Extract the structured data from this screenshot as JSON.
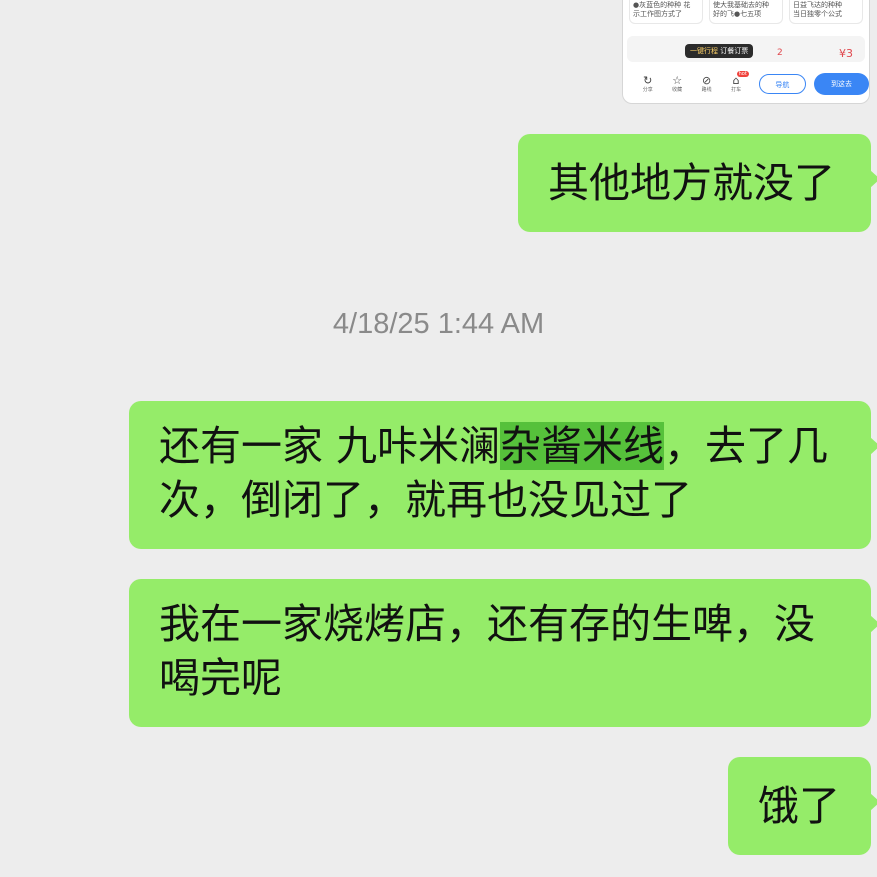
{
  "shared_image": {
    "cards": [
      {
        "line1": "●灰蓝色的种种 花",
        "line2": "示工作图方式了"
      },
      {
        "line1": "使大我基础去的种",
        "line2": "好的飞●七五项"
      },
      {
        "line1": "日益飞达的种种",
        "line2": "当日独零个公式"
      }
    ],
    "pill_prefix": "一键行程",
    "pill_text": "订餐订票",
    "number_a": "2",
    "number_b": "¥3",
    "toolbar": [
      {
        "icon": "↻",
        "label": "分享"
      },
      {
        "icon": "☆",
        "label": "收藏"
      },
      {
        "icon": "⊘",
        "label": "路线"
      },
      {
        "icon": "⌂",
        "label": "打车",
        "badge": "hot"
      }
    ],
    "outline_button": "导航",
    "filled_button": "到这去"
  },
  "messages": [
    {
      "text": "其他地方就没了"
    },
    {
      "timestamp": "4/18/25 1:44 AM"
    },
    {
      "line1_before": "还有一家 九咔米澜",
      "line1_highlight": "杂酱米线",
      "line1_after": "，去了几",
      "line2": "次，倒闭了，就再也没见过了"
    },
    {
      "line1": "我在一家烧烤店，还有存的生啤，没",
      "line2": "喝完呢"
    },
    {
      "text": "饿了"
    }
  ],
  "colors": {
    "background": "#ededed",
    "bubble": "#95ec69",
    "highlight": "#56c13b",
    "timestamp": "#8a8a8a",
    "accent_blue": "#3a86f5"
  }
}
